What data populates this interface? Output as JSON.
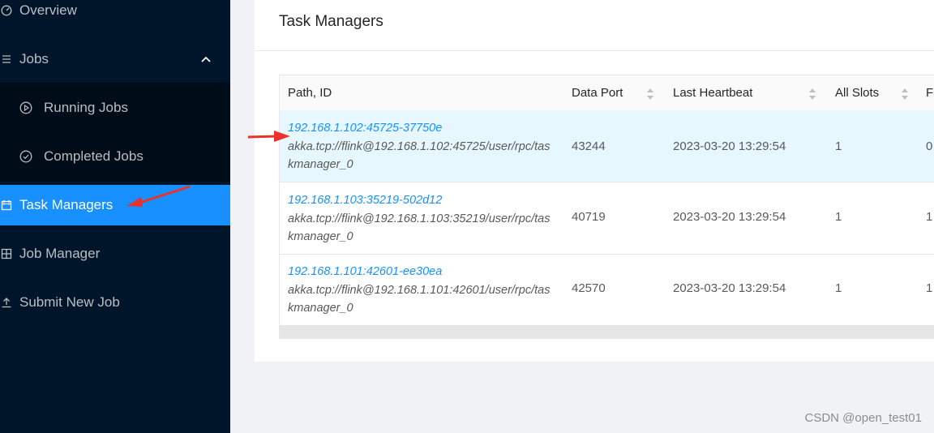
{
  "sidebar": {
    "items": [
      {
        "label": "Overview",
        "icon": "dashboard-icon"
      },
      {
        "label": "Jobs",
        "icon": "bars-icon"
      },
      {
        "label": "Running Jobs",
        "icon": "play-circle-icon"
      },
      {
        "label": "Completed Jobs",
        "icon": "check-circle-icon"
      },
      {
        "label": "Task Managers",
        "icon": "calendar-icon"
      },
      {
        "label": "Job Manager",
        "icon": "build-icon"
      },
      {
        "label": "Submit New Job",
        "icon": "upload-icon"
      }
    ]
  },
  "main": {
    "title": "Task Managers",
    "columns": [
      "Path, ID",
      "Data Port",
      "Last Heartbeat",
      "All Slots",
      "Fr"
    ],
    "rows": [
      {
        "id": "192.168.1.102:45725-37750e",
        "path_line1": "akka.tcp://flink@192.168.1.102:45725/user/rpc/tas",
        "path_line2": "kmanager_0",
        "data_port": "43244",
        "heartbeat": "2023-03-20 13:29:54",
        "all_slots": "1",
        "free": "0"
      },
      {
        "id": "192.168.1.103:35219-502d12",
        "path_line1": "akka.tcp://flink@192.168.1.103:35219/user/rpc/tas",
        "path_line2": "kmanager_0",
        "data_port": "40719",
        "heartbeat": "2023-03-20 13:29:54",
        "all_slots": "1",
        "free": "1"
      },
      {
        "id": "192.168.1.101:42601-ee30ea",
        "path_line1": "akka.tcp://flink@192.168.1.101:42601/user/rpc/tas",
        "path_line2": "kmanager_0",
        "data_port": "42570",
        "heartbeat": "2023-03-20 13:29:54",
        "all_slots": "1",
        "free": "1"
      }
    ]
  },
  "watermark": "CSDN @open_test01",
  "colors": {
    "sidebar_bg": "#001529",
    "active": "#1890ff",
    "link": "#1890ff",
    "annotation": "#e8322b"
  }
}
